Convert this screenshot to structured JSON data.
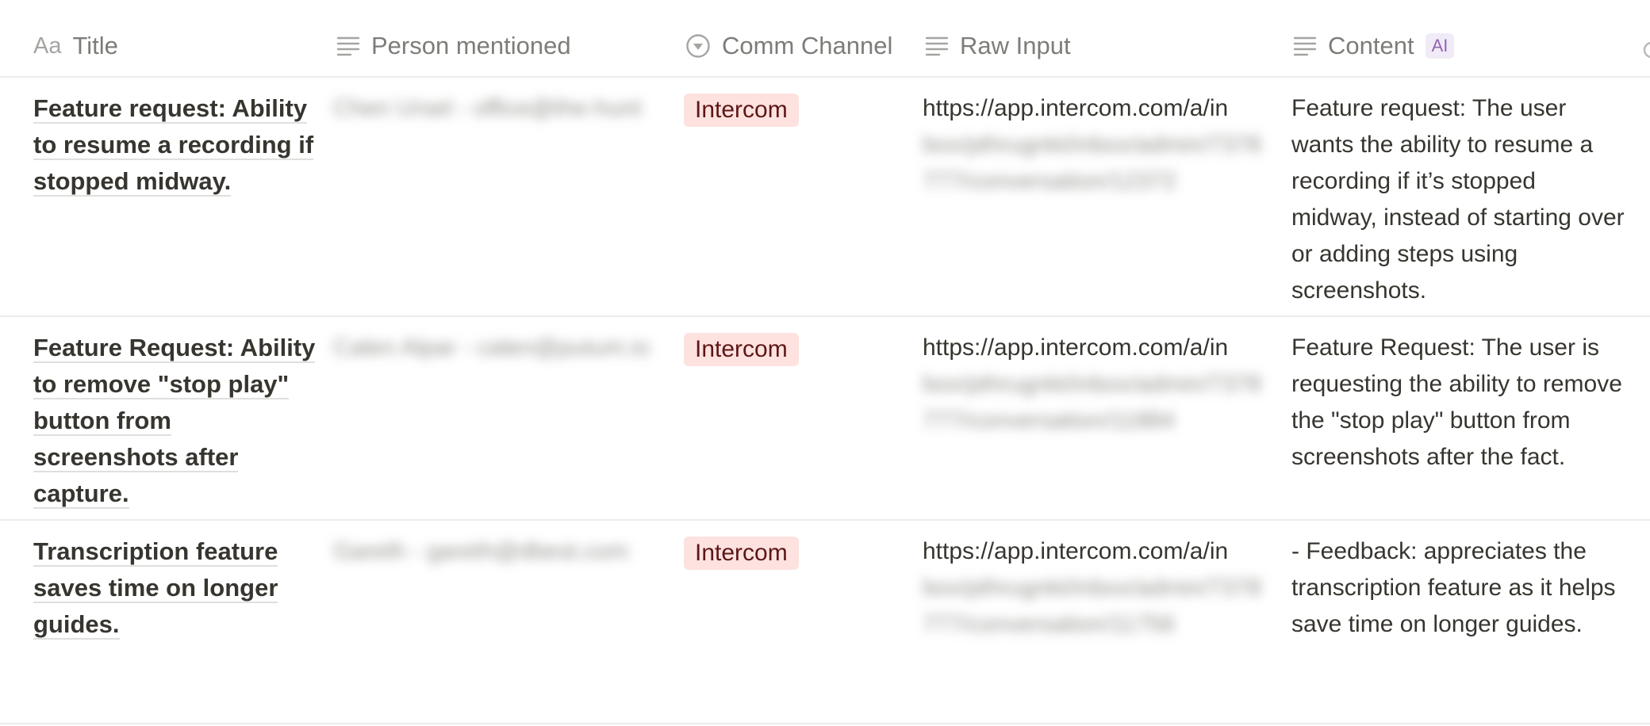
{
  "columns": {
    "title": {
      "label": "Title",
      "icon": "text-aa-icon",
      "icon_text": "Aa"
    },
    "person": {
      "label": "Person mentioned",
      "icon": "text-lines-icon"
    },
    "channel": {
      "label": "Comm Channel",
      "icon": "select-icon"
    },
    "raw": {
      "label": "Raw Input",
      "icon": "text-lines-icon"
    },
    "content": {
      "label": "Content",
      "icon": "text-lines-icon",
      "badge": "AI"
    }
  },
  "colors": {
    "tag_bg": "#fde2e0",
    "tag_text": "#5d1715",
    "ai_badge_bg": "#f1ebf8",
    "ai_badge_text": "#9065b0"
  },
  "rows": [
    {
      "title": "Feature request: Ability to resume a recording if stopped midway.",
      "person": "Chen Ursel - office@the-hunt",
      "channel": "Intercom",
      "raw_visible": "https://app.intercom.com/a/in",
      "raw_blurred": "box/pthrugnkt/inbox/admin/7378777/conversation/12372",
      "content": "Feature request: The user wants the ability to resume a recording if it’s stopped midway, instead of starting over or adding steps using screenshots."
    },
    {
      "title": "Feature Request: Ability to remove \"stop play\" button from screenshots after capture.",
      "person": "Calen Alpar - calen@putum.io",
      "channel": "Intercom",
      "raw_visible": "https://app.intercom.com/a/in",
      "raw_blurred": "box/pthrugnkt/inbox/admin/7378777/conversation/11884",
      "content": "Feature Request: The user is requesting the ability to remove the \"stop play\" button from screenshots after the fact."
    },
    {
      "title": "Transcription feature saves time on longer guides.",
      "person": "Gareth - gareth@dbest.com",
      "channel": "Intercom",
      "raw_visible": "https://app.intercom.com/a/in",
      "raw_blurred": "box/pthrugnkt/inbox/admin/7378777/conversation/11756",
      "content": "- Feedback: appreciates the transcription feature as it helps save time on longer guides."
    }
  ]
}
